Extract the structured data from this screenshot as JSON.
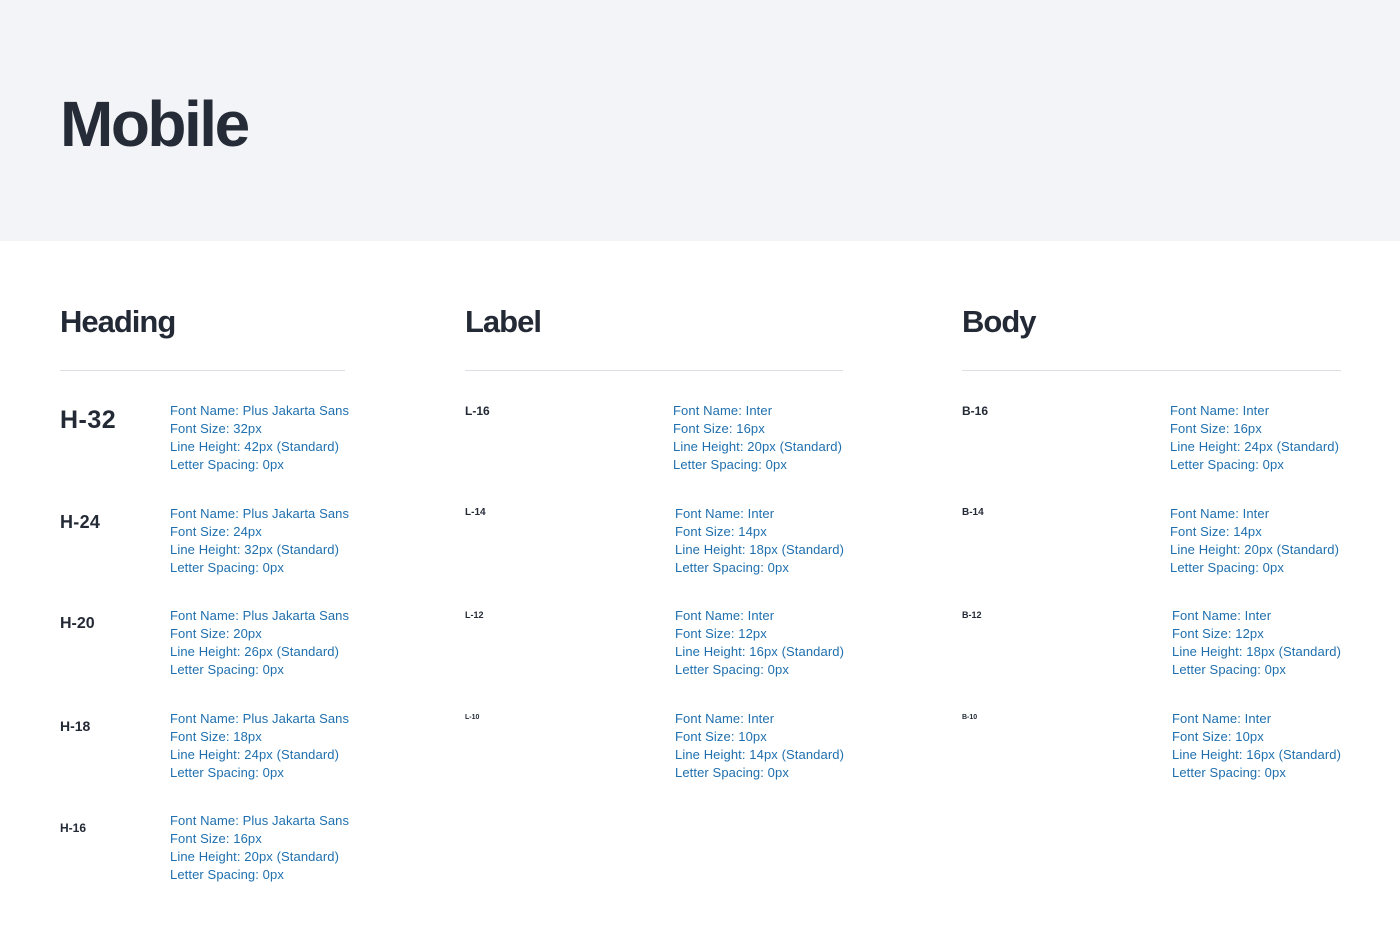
{
  "page": {
    "title": "Mobile"
  },
  "colors": {
    "background_top": "#f2f4f7",
    "text_primary": "#232a35",
    "spec_text": "#1f6fae",
    "rule": "#dcdfe4"
  },
  "columns": [
    {
      "title": "Heading",
      "entries": [
        {
          "name": "H-32",
          "specs": [
            "Font Name: Plus Jakarta Sans",
            "Font Size: 32px",
            "Line Height: 42px (Standard)",
            "Letter Spacing: 0px"
          ]
        },
        {
          "name": "H-24",
          "specs": [
            "Font Name: Plus Jakarta Sans",
            "Font Size: 24px",
            "Line Height: 32px (Standard)",
            "Letter Spacing: 0px"
          ]
        },
        {
          "name": "H-20",
          "specs": [
            "Font Name: Plus Jakarta Sans",
            "Font Size: 20px",
            "Line Height: 26px (Standard)",
            "Letter Spacing: 0px"
          ]
        },
        {
          "name": "H-18",
          "specs": [
            "Font Name: Plus Jakarta Sans",
            "Font Size: 18px",
            "Line Height: 24px (Standard)",
            "Letter Spacing: 0px"
          ]
        },
        {
          "name": "H-16",
          "specs": [
            "Font Name: Plus Jakarta Sans",
            "Font Size: 16px",
            "Line Height: 20px (Standard)",
            "Letter Spacing: 0px"
          ]
        }
      ]
    },
    {
      "title": "Label",
      "entries": [
        {
          "name": "L-16",
          "specs": [
            "Font Name: Inter",
            "Font Size: 16px",
            "Line Height: 20px (Standard)",
            "Letter Spacing: 0px"
          ]
        },
        {
          "name": "L-14",
          "specs": [
            "Font Name: Inter",
            "Font Size: 14px",
            "Line Height: 18px (Standard)",
            "Letter Spacing: 0px"
          ]
        },
        {
          "name": "L-12",
          "specs": [
            "Font Name: Inter",
            "Font Size: 12px",
            "Line Height: 16px (Standard)",
            "Letter Spacing: 0px"
          ]
        },
        {
          "name": "L-10",
          "specs": [
            "Font Name: Inter",
            "Font Size: 10px",
            "Line Height: 14px (Standard)",
            "Letter Spacing: 0px"
          ]
        }
      ]
    },
    {
      "title": "Body",
      "entries": [
        {
          "name": "B-16",
          "specs": [
            "Font Name: Inter",
            "Font Size: 16px",
            "Line Height: 24px (Standard)",
            "Letter Spacing: 0px"
          ]
        },
        {
          "name": "B-14",
          "specs": [
            "Font Name: Inter",
            "Font Size: 14px",
            "Line Height: 20px (Standard)",
            "Letter Spacing: 0px"
          ]
        },
        {
          "name": "B-12",
          "specs": [
            "Font Name: Inter",
            "Font Size: 12px",
            "Line Height: 18px (Standard)",
            "Letter Spacing: 0px"
          ]
        },
        {
          "name": "B-10",
          "specs": [
            "Font Name: Inter",
            "Font Size: 10px",
            "Line Height: 16px (Standard)",
            "Letter Spacing: 0px"
          ]
        }
      ]
    }
  ]
}
